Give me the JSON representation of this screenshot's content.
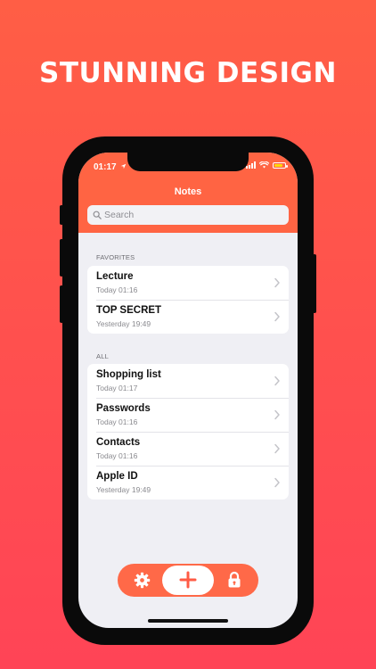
{
  "headline": "STUNNING DESIGN",
  "status": {
    "time": "01:17"
  },
  "nav": {
    "title": "Notes"
  },
  "search": {
    "placeholder": "Search"
  },
  "favorites": {
    "header": "FAVORITES",
    "items": [
      {
        "title": "Lecture",
        "subtitle": "Today 01:16"
      },
      {
        "title": "TOP SECRET",
        "subtitle": "Yesterday 19:49"
      }
    ]
  },
  "all": {
    "header": "ALL",
    "items": [
      {
        "title": "Shopping list",
        "subtitle": "Today 01:17"
      },
      {
        "title": "Passwords",
        "subtitle": "Today 01:16"
      },
      {
        "title": "Contacts",
        "subtitle": "Today 01:16"
      },
      {
        "title": "Apple ID",
        "subtitle": "Yesterday 19:49"
      }
    ]
  },
  "toolbar": {
    "settings_icon": "gear-icon",
    "add_icon": "plus-icon",
    "lock_icon": "lock-icon"
  },
  "colors": {
    "accent": "#ff6443",
    "background_top": "#ff5e45",
    "background_bottom": "#ff4456"
  }
}
